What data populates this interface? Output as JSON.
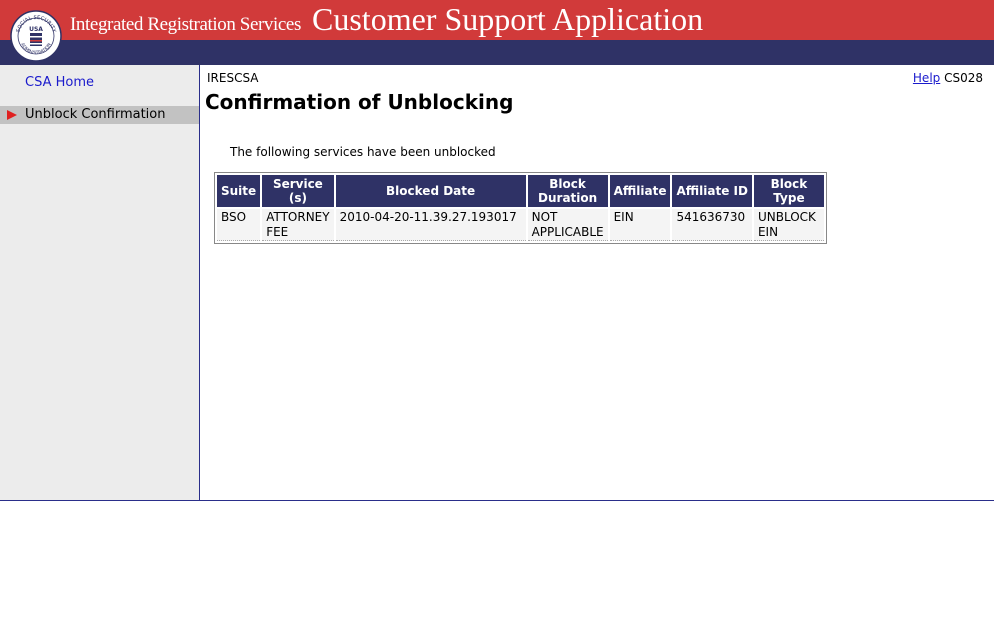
{
  "header": {
    "ires_title": "Integrated Registration Services",
    "app_title": "Customer Support Application",
    "logo_text_top": "SOCIAL SECURITY",
    "logo_text_bottom": "ADMINISTRATION",
    "logo_usa": "USA",
    "colors": {
      "red_band": "#d13a3a",
      "blue_band": "#2f3266"
    }
  },
  "sidebar": {
    "home_label": "CSA Home",
    "active_label": "Unblock Confirmation"
  },
  "main": {
    "app_code": "IRESCSA",
    "help_label": "Help",
    "screen_id": "CS028",
    "heading": "Confirmation of Unblocking",
    "intro": "The following services have been unblocked"
  },
  "table": {
    "headers": [
      [
        "Suite"
      ],
      [
        "Service",
        "(s)"
      ],
      [
        "Blocked Date"
      ],
      [
        "Block",
        "Duration"
      ],
      [
        "Affiliate"
      ],
      [
        "Affiliate ID"
      ],
      [
        "Block",
        "Type"
      ]
    ],
    "rows": [
      [
        [
          "BSO"
        ],
        [
          "ATTORNEY",
          "FEE"
        ],
        [
          "2010-04-20-11.39.27.193017"
        ],
        [
          "NOT",
          "APPLICABLE"
        ],
        [
          "EIN"
        ],
        [
          "541636730"
        ],
        [
          "UNBLOCK",
          "EIN"
        ]
      ]
    ]
  }
}
